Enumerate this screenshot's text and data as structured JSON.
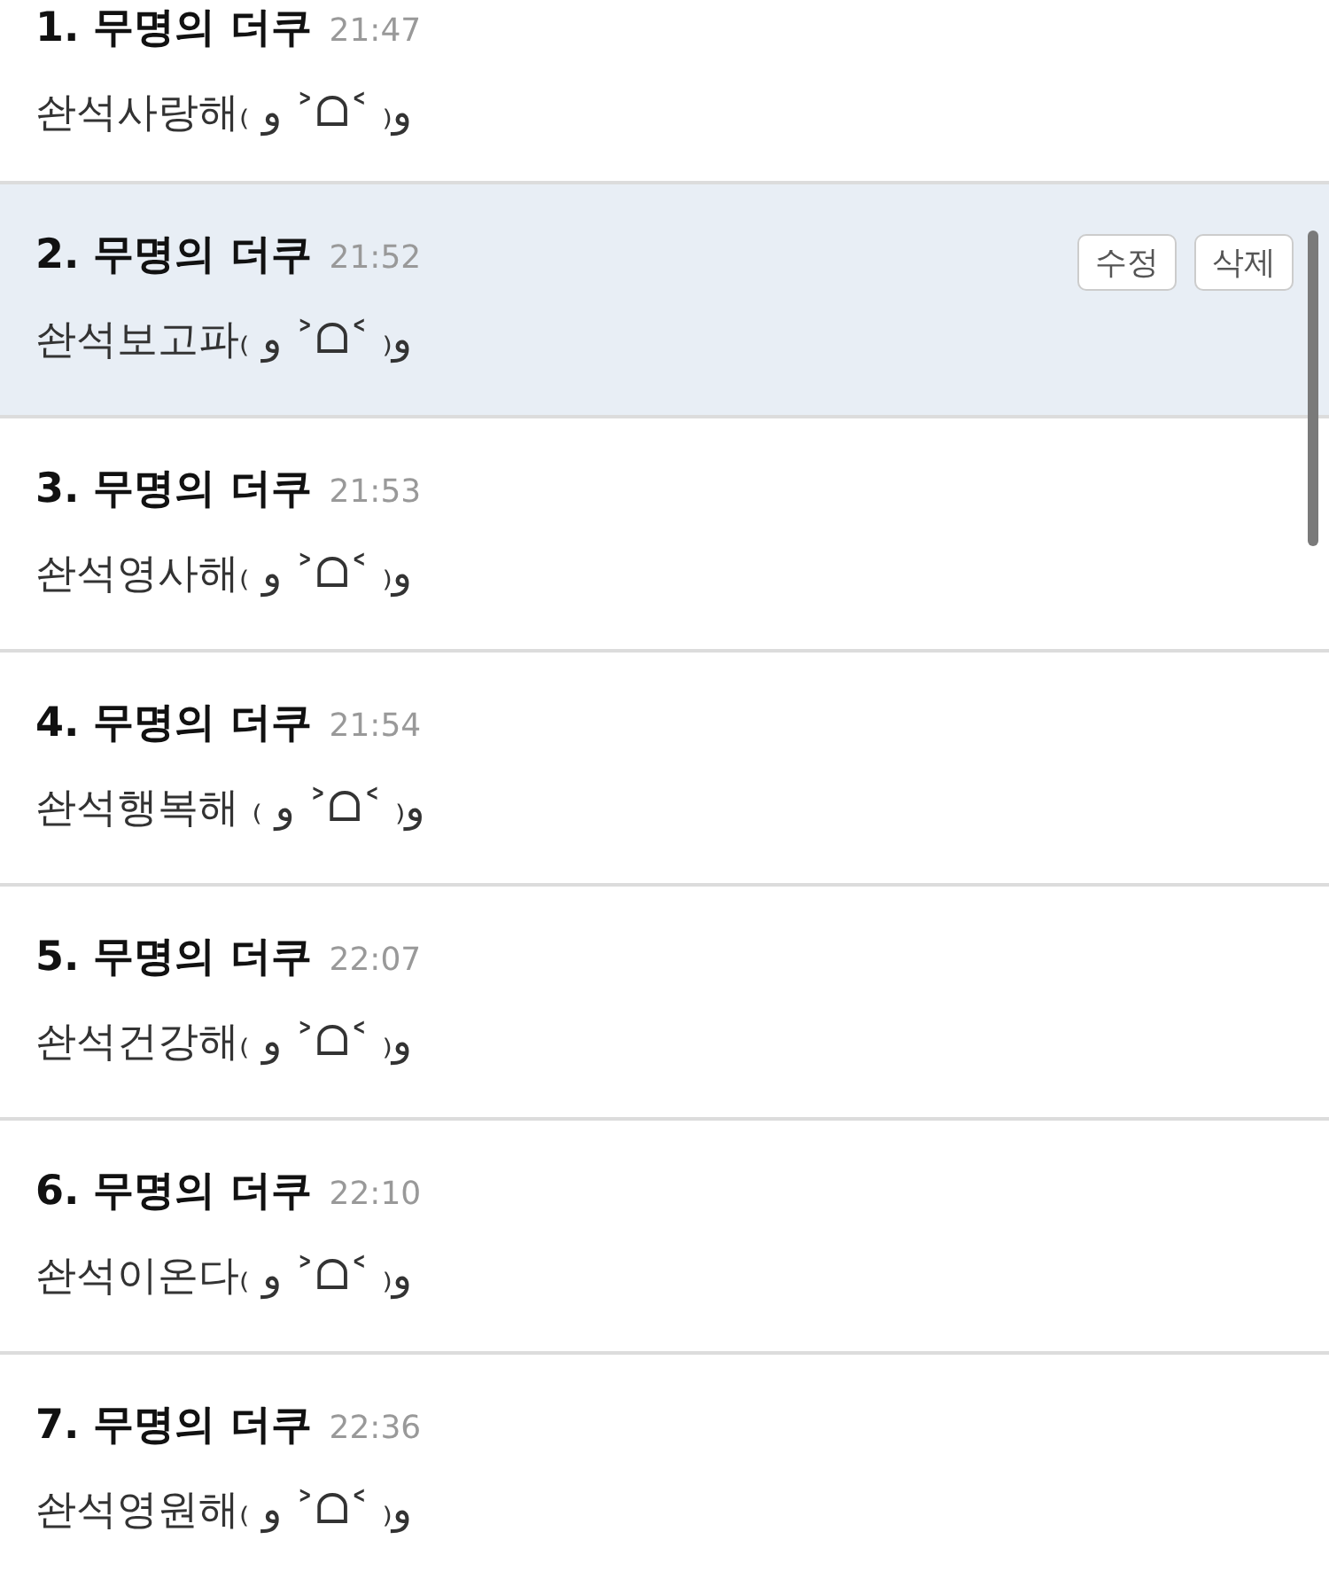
{
  "comments": [
    {
      "title": "1. 무명의 더쿠",
      "time": "21:47",
      "text": "솬석사랑해₍ و ˃ᗝ˂ ₎و",
      "selected": false
    },
    {
      "title": "2. 무명의 더쿠",
      "time": "21:52",
      "text": "솬석보고파₍ و ˃ᗝ˂ ₎و",
      "selected": true,
      "edit_label": "수정",
      "delete_label": "삭제"
    },
    {
      "title": "3. 무명의 더쿠",
      "time": "21:53",
      "text": "솬석영사해₍ و ˃ᗝ˂ ₎و",
      "selected": false
    },
    {
      "title": "4. 무명의 더쿠",
      "time": "21:54",
      "text": "솬석행복해 ₍ و ˃ᗝ˂ ₎و",
      "selected": false
    },
    {
      "title": "5. 무명의 더쿠",
      "time": "22:07",
      "text": "솬석건강해₍ و ˃ᗝ˂ ₎و",
      "selected": false
    },
    {
      "title": "6. 무명의 더쿠",
      "time": "22:10",
      "text": "솬석이온다₍ و ˃ᗝ˂ ₎و",
      "selected": false
    },
    {
      "title": "7. 무명의 더쿠",
      "time": "22:36",
      "text": "솬석영원해₍ و ˃ᗝ˂ ₎و",
      "selected": false
    }
  ]
}
